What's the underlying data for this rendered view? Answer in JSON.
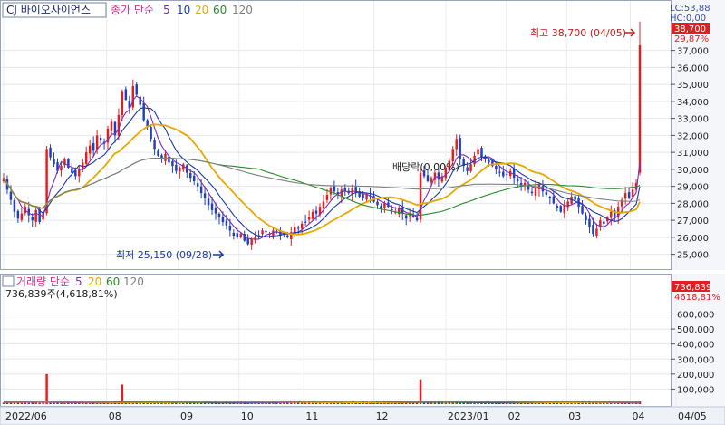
{
  "chart_data": [
    {
      "type": "candlestick",
      "title": "CJ 바이오사이언스",
      "legend": {
        "indicator": "종가 단순",
        "periods": [
          "5",
          "10",
          "20",
          "60",
          "120"
        ],
        "colors": [
          "#7b2fb8",
          "#1a3aa8",
          "#e8a800",
          "#2a8a2a",
          "#808080"
        ]
      },
      "status": [
        "LC:53,88",
        "HC:0,00"
      ],
      "price_axis": {
        "ticks": [
          "37,000",
          "36,000",
          "35,000",
          "34,000",
          "33,000",
          "32,000",
          "31,000",
          "30,000",
          "29,000",
          "28,000",
          "27,000",
          "26,000",
          "25,000"
        ],
        "ylim": [
          24500,
          38900
        ]
      },
      "last_price_tag": "38,700",
      "last_change_tag": "29,87%",
      "annotations": {
        "high": "최고 38,700 (04/05)",
        "low": "최저 25,150 (09/28)",
        "dividend": "배당락(0,00%)"
      },
      "x_ticks": [
        "2022/06",
        "08",
        "09",
        "10",
        "11",
        "12",
        "2023/01",
        "02",
        "03",
        "04",
        "04/05"
      ],
      "close": [
        29500,
        28800,
        28200,
        27500,
        27100,
        27400,
        27800,
        27300,
        27000,
        27600,
        26900,
        27400,
        31200,
        30700,
        30300,
        29900,
        30200,
        30600,
        30100,
        29800,
        29600,
        30000,
        30400,
        31000,
        31400,
        31100,
        32000,
        31700,
        31500,
        32400,
        32800,
        32000,
        33200,
        34600,
        34100,
        33600,
        34900,
        34400,
        33800,
        32900,
        32500,
        31800,
        31200,
        30800,
        30600,
        30900,
        30400,
        30200,
        29900,
        30100,
        30300,
        29800,
        29500,
        29300,
        29000,
        28600,
        28300,
        27900,
        27600,
        27400,
        27200,
        26900,
        26700,
        26400,
        26100,
        26000,
        26200,
        25800,
        25600,
        25900,
        26000,
        26100,
        26400,
        26300,
        26200,
        26400,
        26300,
        26100,
        26200,
        26000,
        26300,
        26600,
        26500,
        26800,
        26900,
        27200,
        27500,
        27400,
        27800,
        28100,
        28500,
        28900,
        28700,
        28500,
        28800,
        28700,
        28600,
        28900,
        28600,
        28400,
        28300,
        28500,
        28400,
        28100,
        27900,
        27700,
        28000,
        27800,
        27600,
        27500,
        27700,
        27400,
        27100,
        27300,
        27200,
        27000,
        29800,
        29600,
        29300,
        29500,
        29800,
        29400,
        29600,
        30100,
        30500,
        31200,
        31800,
        30600,
        30200,
        29900,
        30300,
        30800,
        31200,
        30700,
        30600,
        30400,
        30200,
        30000,
        29800,
        29600,
        29700,
        29900,
        29500,
        29300,
        29000,
        29200,
        28800,
        28600,
        28900,
        29100,
        28700,
        28500,
        28300,
        28000,
        27700,
        27500,
        27900,
        28100,
        28400,
        28200,
        27800,
        27400,
        27000,
        26600,
        26200,
        26500,
        27000,
        26800,
        27200,
        27500,
        27100,
        27800,
        28200,
        28600,
        28300,
        28800,
        29200,
        37300
      ],
      "volume_panel": {
        "indicator": "거래량 단순",
        "periods": [
          "5",
          "20",
          "60",
          "120"
        ],
        "readout": "736,839주(4,618,81%)",
        "last_volume_tag": "736,839",
        "last_ratio_tag": "4618,81%",
        "ticks": [
          "600,000",
          "500,000",
          "400,000",
          "300,000",
          "200,000",
          "100,000"
        ],
        "ylim": [
          0,
          760000
        ],
        "spikes": {
          "12": 200000,
          "33": 130000,
          "116": 165000,
          "184": 736839
        }
      }
    }
  ]
}
